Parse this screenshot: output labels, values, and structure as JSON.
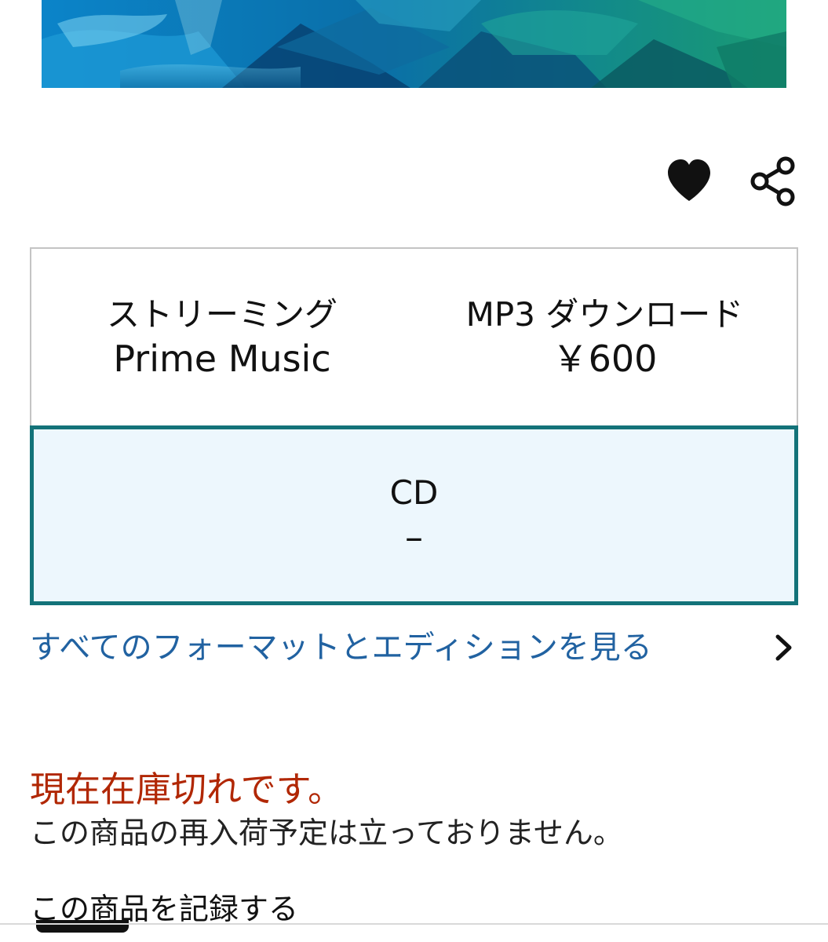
{
  "product": {
    "cover_image": "album-cover-art"
  },
  "actions": {
    "wishlist_icon": "heart-icon",
    "share_icon": "share-icon"
  },
  "formats": [
    {
      "label": "ストリーミング",
      "price": "Prime Music",
      "selected": false
    },
    {
      "label": "MP3 ダウンロード",
      "price": "￥600",
      "selected": false
    },
    {
      "label": "CD",
      "price": "–",
      "selected": true
    }
  ],
  "see_all_formats": {
    "label": "すべてのフォーマットとエディションを見る",
    "icon": "chevron-right-icon"
  },
  "availability": {
    "status": "現在在庫切れです。",
    "note": "この商品の再入荷予定は立っておりません。"
  },
  "save_item": {
    "label": "この商品を記録する"
  },
  "colors": {
    "link": "#2162a1",
    "out_of_stock": "#b12704",
    "selected_border": "#137379",
    "selected_background": "#edf7fd"
  }
}
